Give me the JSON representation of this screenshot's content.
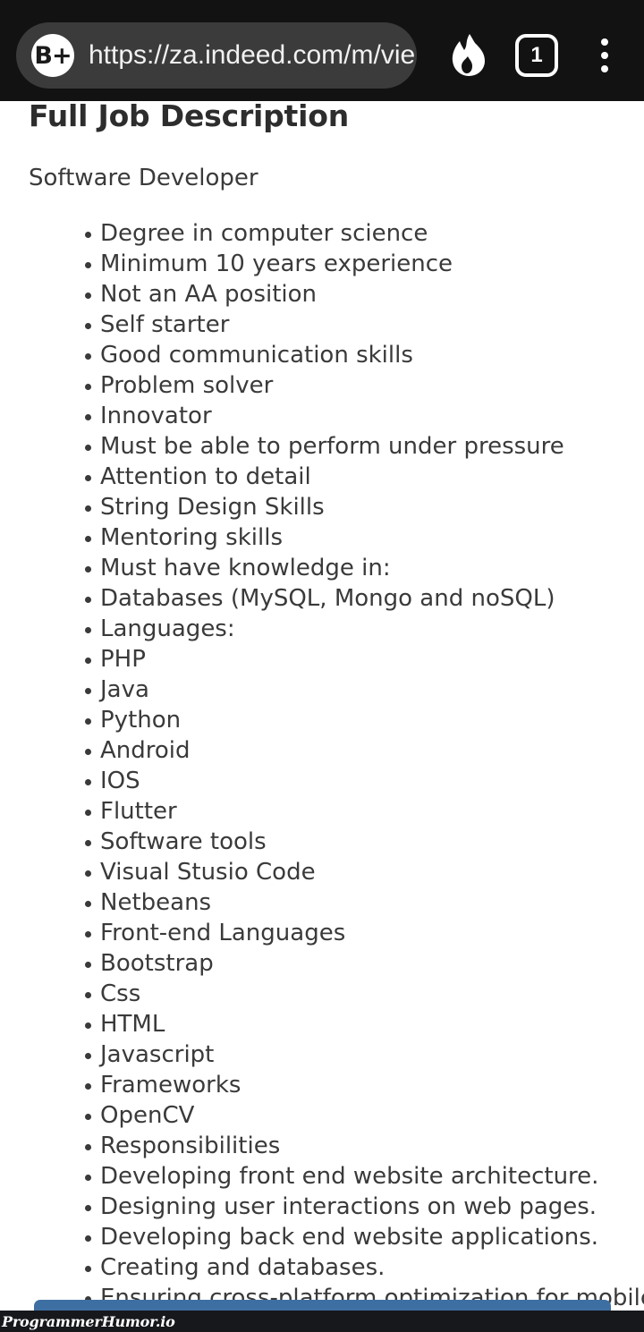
{
  "browser": {
    "url": "https://za.indeed.com/m/vie",
    "brave_badge_label": "B+",
    "shield_icon": "flame-icon",
    "tab_count": "1",
    "menu_icon": "three-dot-menu-icon"
  },
  "page": {
    "heading": "Full Job Description",
    "job_title": "Software Developer",
    "bullets": [
      "Degree in computer science",
      "Minimum 10 years experience",
      "Not an AA position",
      "Self starter",
      "Good communication skills",
      "Problem solver",
      "Innovator",
      "Must be able to perform under pressure",
      "Attention to detail",
      "String Design Skills",
      "Mentoring skills",
      "Must have knowledge in:",
      "Databases (MySQL, Mongo and noSQL)",
      "Languages:",
      "PHP",
      "Java",
      "Python",
      "Android",
      "IOS",
      "Flutter",
      "Software tools",
      "Visual Stusio Code",
      "Netbeans",
      "Front-end Languages",
      "Bootstrap",
      "Css",
      "HTML",
      "Javascript",
      "Frameworks",
      "OpenCV",
      "Responsibilities",
      "Developing front end website architecture.",
      "Designing user interactions on web pages.",
      "Developing back end website applications.",
      "Creating and databases.",
      "Ensuring cross-platform optimization for mobile"
    ]
  },
  "footer": {
    "watermark": "ProgrammerHumor.io"
  },
  "colors": {
    "toolbar_bg": "#121212",
    "url_pill_bg": "#3b3b3b",
    "page_bg": "#ffffff",
    "text": "#3a3a3a",
    "accent_blue": "#3e6fa3"
  }
}
